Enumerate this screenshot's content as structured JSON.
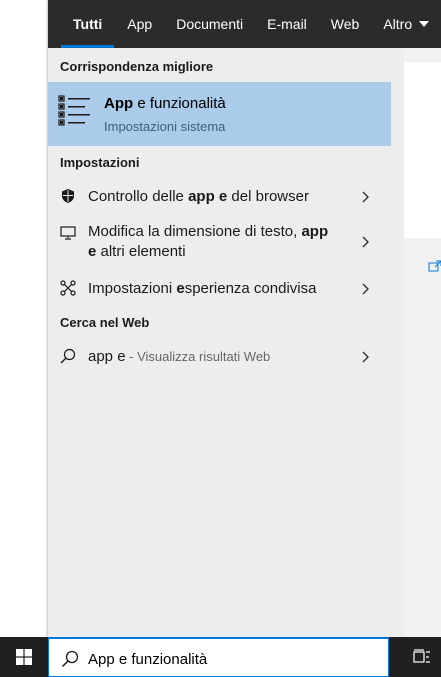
{
  "tabs": [
    {
      "label": "Tutti",
      "active": true
    },
    {
      "label": "App"
    },
    {
      "label": "Documenti"
    },
    {
      "label": "E-mail"
    },
    {
      "label": "Web"
    },
    {
      "label": "Altro"
    }
  ],
  "best_match": {
    "header": "Corrispondenza migliore",
    "title_bold": "App",
    "title_mid": " e ",
    "title_rest": "funzionalità",
    "subtitle": "Impostazioni sistema",
    "icon": "apps-features-list-icon"
  },
  "settings": {
    "header": "Impostazioni",
    "items": [
      {
        "icon": "shield-icon",
        "pre": "Controllo delle ",
        "bold": "app e",
        "post": " del browser"
      },
      {
        "icon": "monitor-icon",
        "line1_pre": "Modifica la dimensione di testo, ",
        "line1_bold": "app",
        "line2_bold": "e",
        "line2_post": " altri elementi"
      },
      {
        "icon": "shared-experiences-icon",
        "pre": "Impostazioni ",
        "bold": "e",
        "post": "sperienza condivisa"
      }
    ]
  },
  "web": {
    "header": "Cerca nel Web",
    "query": "app e",
    "suffix": " - Visualizza risultati Web",
    "icon": "search-icon"
  },
  "taskbar": {
    "search_value": "App e funzionalità",
    "start_icon": "windows-logo-icon",
    "task_view_icon": "task-view-icon"
  },
  "colors": {
    "accent": "#0078d7",
    "highlight": "#aacbe9",
    "tabbar": "#2b2b2b",
    "panel": "#ededed"
  }
}
